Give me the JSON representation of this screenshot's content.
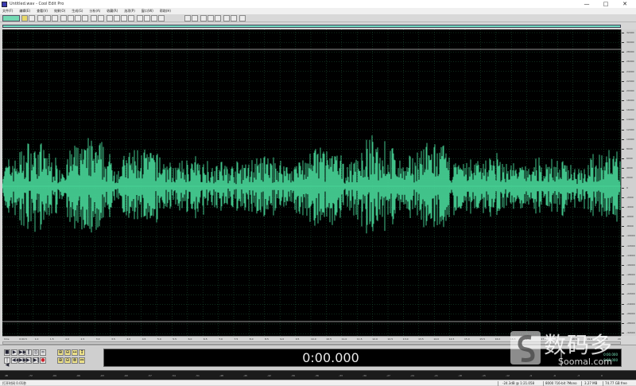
{
  "window": {
    "title": "Untitled.wav - Cool Edit Pro",
    "minimize": "—",
    "maximize": "□",
    "close": "✕"
  },
  "menu": {
    "items": [
      "文件(F)",
      "编辑(E)",
      "查看(V)",
      "效果(O)",
      "生成(G)",
      "分析(A)",
      "收藏(R)",
      "选项(P)",
      "窗口(W)",
      "帮助(H)"
    ]
  },
  "waveform": {
    "background": "#000000",
    "wave_color": "#49d99a",
    "grid_color": "#1e5a3a",
    "amplitude_scale": [
      "32000",
      "30000",
      "28000",
      "26000",
      "24000",
      "22000",
      "20000",
      "18000",
      "16000",
      "14000",
      "12000",
      "10000",
      "8000",
      "6000",
      "4000",
      "2000",
      "0",
      "-2000",
      "-4000",
      "-6000",
      "-8000",
      "-10000",
      "-12000",
      "-14000",
      "-16000",
      "-18000",
      "-20000",
      "-22000",
      "-24000",
      "-26000",
      "-28000",
      "-32000"
    ]
  },
  "time_ruler": {
    "labels": [
      "hms",
      "0:00.5",
      "1.0",
      "1.5",
      "2.0",
      "2.5",
      "3.0",
      "3.5",
      "4.0",
      "4.5",
      "5.0",
      "5.5",
      "6.0",
      "6.5",
      "7.0",
      "7.5",
      "8.0",
      "8.5",
      "9.0",
      "9.5",
      "10.0",
      "10.5",
      "11.0",
      "11.5",
      "12.0",
      "12.5",
      "13.0",
      "13.5",
      "14.0",
      "14.5",
      "15.0",
      "15.5",
      "16.0",
      "16.5",
      "17.0",
      "17.5",
      "18.0",
      "18.5",
      "19.0",
      "19.5",
      "20.0"
    ]
  },
  "transport": {
    "row1": [
      "■",
      "▶",
      "▶▶",
      "‖",
      "◎",
      "∞"
    ],
    "row2": [
      "|◀",
      "◀◀",
      "▶▶",
      "▶|",
      "▶‖",
      "●"
    ],
    "zoom_row1": [
      "⊕",
      "⊖",
      "↔",
      "↕"
    ],
    "zoom_row2": [
      "⊕",
      "⊖",
      "⊗",
      "⇔"
    ]
  },
  "time_display": {
    "current": "0:00.000",
    "sel_begin": "0:00.000",
    "sel_end": "0:00.000"
  },
  "level_meter": {
    "labels": [
      "dB",
      "-72",
      "-69",
      "-66",
      "-63",
      "-60",
      "-57",
      "-54",
      "-51",
      "-48",
      "-45",
      "-42",
      "-39",
      "-36",
      "-33",
      "-30",
      "-27",
      "-24",
      "-21",
      "-18",
      "-15",
      "-12",
      "-9",
      "-6",
      "-3",
      "0"
    ]
  },
  "status": {
    "left": "打开时间 0.01秒",
    "db": "-24.3dB @ 1:21.058",
    "format": "8000 ?16-bit ?Mono",
    "size": "3.27 MB",
    "free": "74.77 GB free"
  },
  "watermark": {
    "text": "数码多",
    "sub": "Sooma",
    "sub2": "l.com"
  }
}
